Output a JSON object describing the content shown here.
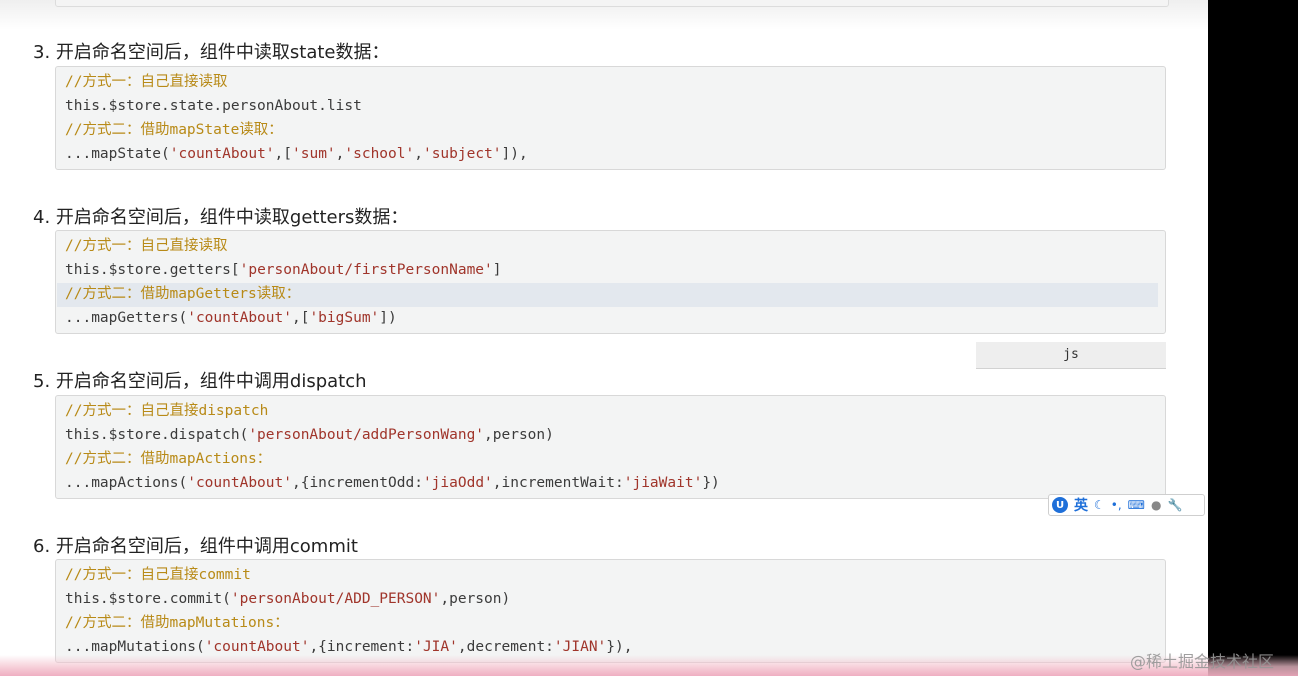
{
  "sections": [
    {
      "heading": "3. 开启命名空间后，组件中读取state数据：",
      "lines": [
        [
          {
            "t": "//方式一：自己直接读取",
            "c": "cmt"
          }
        ],
        [
          {
            "t": "this.$store.state.personAbout.list",
            "c": ""
          }
        ],
        [
          {
            "t": "//方式二：借助mapState读取：",
            "c": "cmt"
          }
        ],
        [
          {
            "t": "...mapState(",
            "c": ""
          },
          {
            "t": "'countAbout'",
            "c": "str"
          },
          {
            "t": ",[",
            "c": ""
          },
          {
            "t": "'sum'",
            "c": "str"
          },
          {
            "t": ",",
            "c": ""
          },
          {
            "t": "'school'",
            "c": "str"
          },
          {
            "t": ",",
            "c": ""
          },
          {
            "t": "'subject'",
            "c": "str"
          },
          {
            "t": "]),",
            "c": ""
          }
        ]
      ]
    },
    {
      "heading": "4. 开启命名空间后，组件中读取getters数据：",
      "lines": [
        [
          {
            "t": "//方式一：自己直接读取",
            "c": "cmt"
          }
        ],
        [
          {
            "t": "this.$store.getters[",
            "c": ""
          },
          {
            "t": "'personAbout/firstPersonName'",
            "c": "str"
          },
          {
            "t": "]",
            "c": ""
          }
        ],
        [
          {
            "t": "//方式二：借助mapGetters读取：",
            "c": "cmt"
          }
        ],
        [
          {
            "t": "...mapGetters(",
            "c": ""
          },
          {
            "t": "'countAbout'",
            "c": "str"
          },
          {
            "t": ",[",
            "c": ""
          },
          {
            "t": "'bigSum'",
            "c": "str"
          },
          {
            "t": "])",
            "c": ""
          }
        ]
      ]
    },
    {
      "heading": "5. 开启命名空间后，组件中调用dispatch",
      "lines": [
        [
          {
            "t": "//方式一：自己直接dispatch",
            "c": "cmt"
          }
        ],
        [
          {
            "t": "this.$store.dispatch(",
            "c": ""
          },
          {
            "t": "'personAbout/addPersonWang'",
            "c": "str"
          },
          {
            "t": ",person)",
            "c": ""
          }
        ],
        [
          {
            "t": "//方式二：借助mapActions：",
            "c": "cmt"
          }
        ],
        [
          {
            "t": "...mapActions(",
            "c": ""
          },
          {
            "t": "'countAbout'",
            "c": "str"
          },
          {
            "t": ",{incrementOdd:",
            "c": ""
          },
          {
            "t": "'jiaOdd'",
            "c": "str"
          },
          {
            "t": ",incrementWait:",
            "c": ""
          },
          {
            "t": "'jiaWait'",
            "c": "str"
          },
          {
            "t": "})",
            "c": ""
          }
        ]
      ]
    },
    {
      "heading": "6. 开启命名空间后，组件中调用commit",
      "lines": [
        [
          {
            "t": "//方式一：自己直接commit",
            "c": "cmt"
          }
        ],
        [
          {
            "t": "this.$store.commit(",
            "c": ""
          },
          {
            "t": "'personAbout/ADD_PERSON'",
            "c": "str"
          },
          {
            "t": ",person)",
            "c": ""
          }
        ],
        [
          {
            "t": "//方式二：借助mapMutations：",
            "c": "cmt"
          }
        ],
        [
          {
            "t": "...mapMutations(",
            "c": ""
          },
          {
            "t": "'countAbout'",
            "c": "str"
          },
          {
            "t": ",{increment:",
            "c": ""
          },
          {
            "t": "'JIA'",
            "c": "str"
          },
          {
            "t": ",decrement:",
            "c": ""
          },
          {
            "t": "'JIAN'",
            "c": "str"
          },
          {
            "t": "}),",
            "c": ""
          }
        ]
      ]
    }
  ],
  "code_lang_label": "js",
  "ime_toolbar": {
    "logo": "U",
    "mode": "英",
    "icons": [
      "moon-icon",
      "punctuation-icon",
      "keyboard-icon",
      "user-icon",
      "wrench-icon"
    ]
  },
  "watermark": "@稀土掘金技术社区",
  "colors": {
    "comment": "#b88a17",
    "string": "#a0352b",
    "code_bg": "#f3f4f4",
    "highlight": "#e3e8ee"
  }
}
